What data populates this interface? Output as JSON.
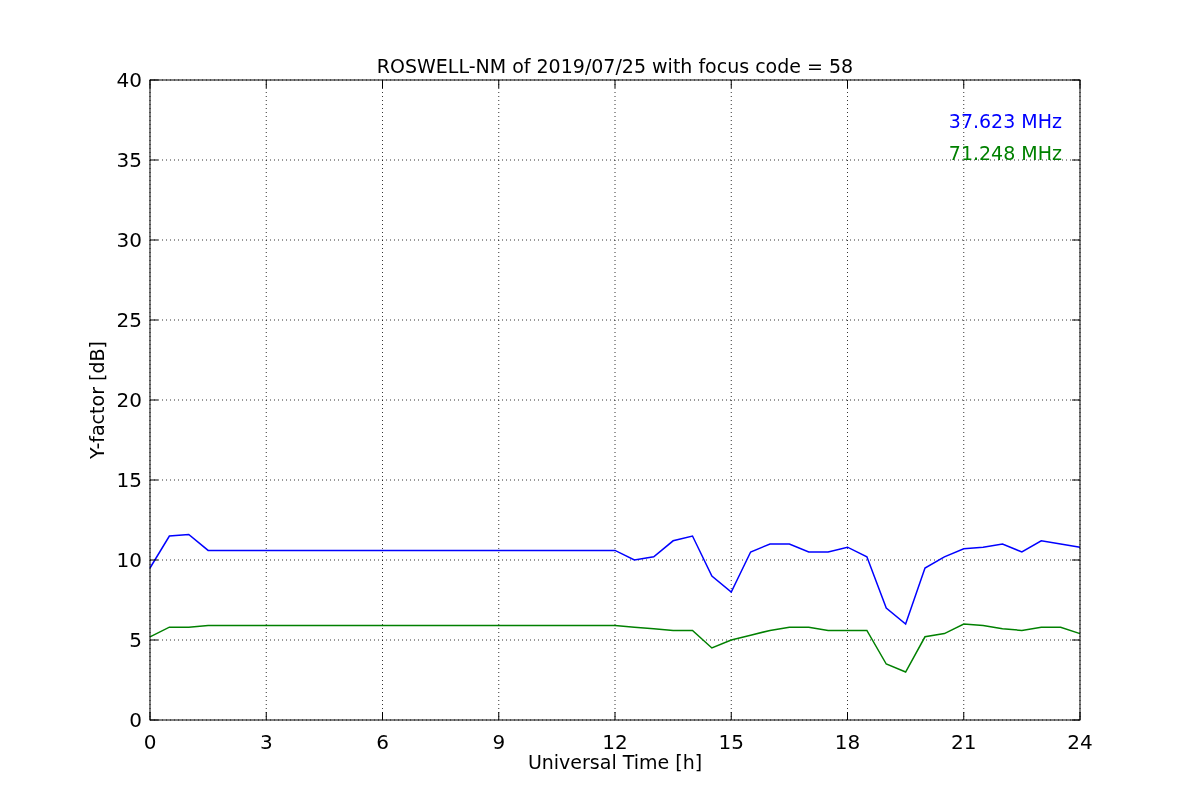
{
  "chart_data": {
    "type": "line",
    "title": "ROSWELL-NM of 2019/07/25 with focus code = 58",
    "xlabel": "Universal Time [h]",
    "ylabel": "Y-factor [dB]",
    "x": [
      0,
      0.5,
      1,
      1.5,
      2,
      2.5,
      3,
      3.5,
      4,
      4.5,
      5,
      5.5,
      6,
      6.5,
      7,
      7.5,
      8,
      8.5,
      9,
      9.5,
      10,
      10.5,
      11,
      11.5,
      12,
      12.5,
      13,
      13.5,
      14,
      14.5,
      15,
      15.5,
      16,
      16.5,
      17,
      17.5,
      18,
      18.5,
      19,
      19.5,
      20,
      20.5,
      21,
      21.5,
      22,
      22.5,
      23,
      23.5,
      24
    ],
    "series": [
      {
        "name": "37.623 MHz",
        "color": "#0000ff",
        "values": [
          9.5,
          11.5,
          11.6,
          10.6,
          10.6,
          10.6,
          10.6,
          10.6,
          10.6,
          10.6,
          10.6,
          10.6,
          10.6,
          10.6,
          10.6,
          10.6,
          10.6,
          10.6,
          10.6,
          10.6,
          10.6,
          10.6,
          10.6,
          10.6,
          10.6,
          10.0,
          10.2,
          11.2,
          11.5,
          9,
          8,
          10.5,
          11,
          11,
          10.5,
          10.5,
          10.8,
          10.2,
          7,
          6,
          9.5,
          10.2,
          10.7,
          10.8,
          11,
          10.5,
          11.2,
          11,
          10.8
        ]
      },
      {
        "name": "71.248 MHz",
        "color": "#008000",
        "values": [
          5.2,
          5.8,
          5.8,
          5.9,
          5.9,
          5.9,
          5.9,
          5.9,
          5.9,
          5.9,
          5.9,
          5.9,
          5.9,
          5.9,
          5.9,
          5.9,
          5.9,
          5.9,
          5.9,
          5.9,
          5.9,
          5.9,
          5.9,
          5.9,
          5.9,
          5.8,
          5.7,
          5.6,
          5.6,
          4.5,
          5,
          5.3,
          5.6,
          5.8,
          5.8,
          5.6,
          5.6,
          5.6,
          3.5,
          3,
          5.2,
          5.4,
          6,
          5.9,
          5.7,
          5.6,
          5.8,
          5.8,
          5.4
        ]
      }
    ],
    "grid": true,
    "xlim": [
      0,
      24
    ],
    "ylim": [
      0,
      40
    ],
    "xticks": [
      0,
      3,
      6,
      9,
      12,
      15,
      18,
      21,
      24
    ],
    "yticks": [
      0,
      5,
      10,
      15,
      20,
      25,
      30,
      35,
      40
    ]
  }
}
